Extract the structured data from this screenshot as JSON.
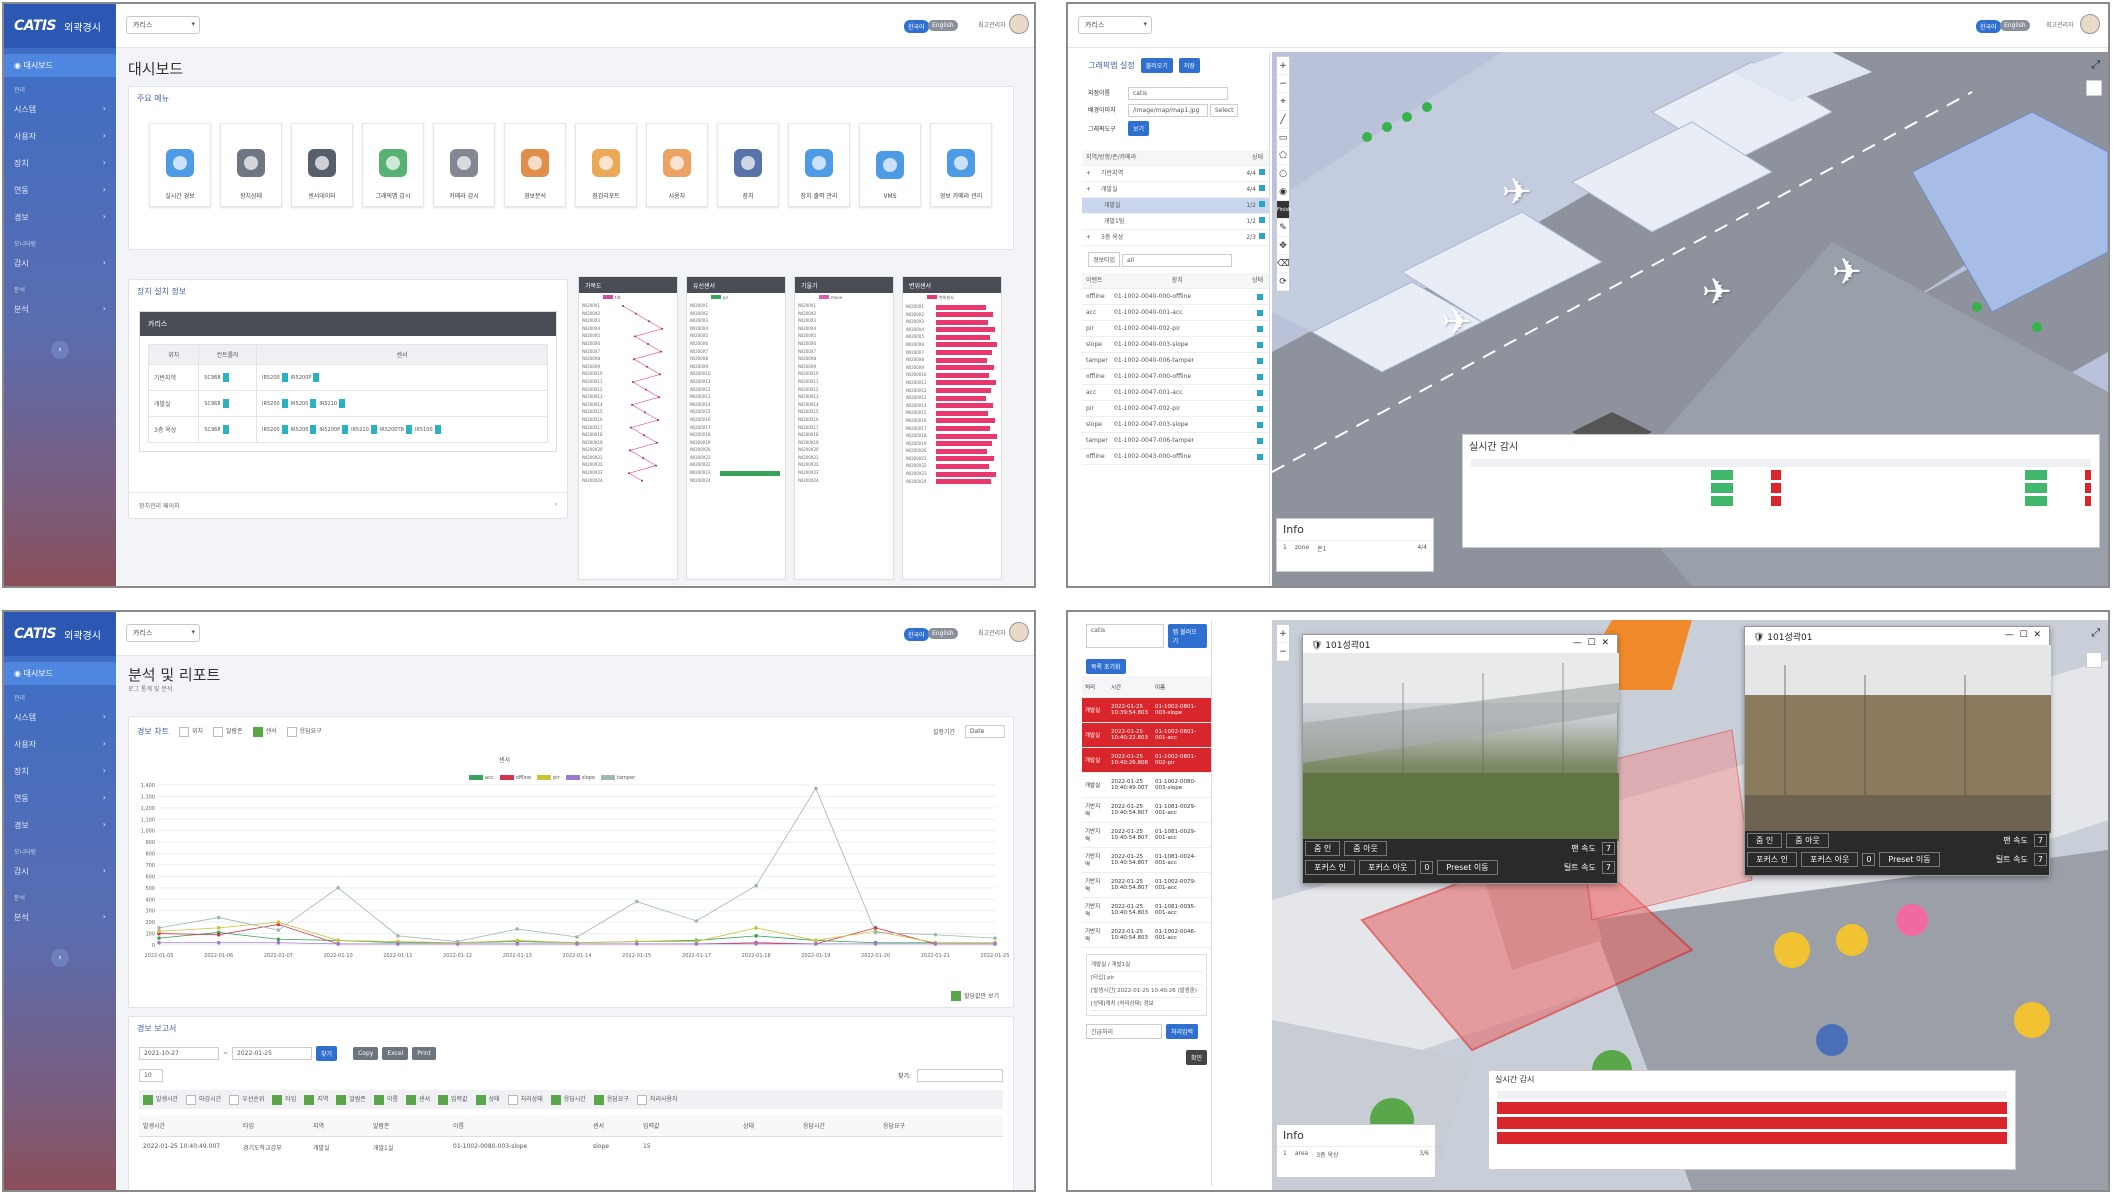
{
  "common": {
    "brand_logo": "CATIS",
    "brand_title": "외곽경시",
    "site_select": "카리스",
    "lang_ko": "한국어",
    "lang_en": "English",
    "user": "최고관리자",
    "sidebar": {
      "active": "대시보드",
      "groups": [
        "관리",
        "모니터링",
        "분석"
      ],
      "items": [
        "시스템",
        "사용자",
        "장치",
        "연동",
        "경보"
      ],
      "items2": [
        "감시"
      ],
      "items3": [
        "분석"
      ],
      "collapse": "‹"
    }
  },
  "dashboard": {
    "title": "대시보드",
    "main_menu_title": "주요 메뉴",
    "menu": [
      {
        "label": "실시간 경보",
        "icon": "siren-icon"
      },
      {
        "label": "장치상태",
        "icon": "server-status-icon"
      },
      {
        "label": "센서데이터",
        "icon": "drone-icon"
      },
      {
        "label": "그래픽맵 감시",
        "icon": "map-icon"
      },
      {
        "label": "카메라 감시",
        "icon": "cctv-icon"
      },
      {
        "label": "경보분석",
        "icon": "presentation-icon"
      },
      {
        "label": "점검리포트",
        "icon": "clipboard-icon"
      },
      {
        "label": "사용자",
        "icon": "user-icon"
      },
      {
        "label": "장치",
        "icon": "gear-network-icon"
      },
      {
        "label": "장치 출력 관리",
        "icon": "database-icon"
      },
      {
        "label": "VMS",
        "icon": "folder-camera-icon"
      },
      {
        "label": "경보 카메라 관리",
        "icon": "db-camera-icon"
      }
    ],
    "device_title": "장치 설치 정보",
    "device_site": "카리스",
    "device_headers": [
      "위치",
      "컨트롤러",
      "센서"
    ],
    "device_rows": [
      {
        "loc": "기반지역",
        "ctrl": "SC968",
        "sensors": [
          "IR5200",
          "IR5200P"
        ]
      },
      {
        "loc": "개발실",
        "ctrl": "SC968",
        "sensors": [
          "IR5200",
          "IR5200",
          "IR5210"
        ]
      },
      {
        "loc": "3층 옥상",
        "ctrl": "SC968",
        "sensors": [
          "IR5200",
          "IR5200",
          "IR5200P",
          "IR5210",
          "IR5200TB",
          "IR5100"
        ]
      }
    ],
    "device_footer": "장치관리 페이지",
    "mini_titles": [
      "가복도",
      "유선센서",
      "기울기",
      "변위센서"
    ],
    "mini_legends": [
      "tilt",
      "pir",
      "move",
      "변위센서"
    ],
    "mini_rows": [
      "IW200X1",
      "IW200X2",
      "IW200X3",
      "IW200X4",
      "IW200X5",
      "IW200X6",
      "IW200X7",
      "IW200X8",
      "IW200X9",
      "IW200X10",
      "IW200X11",
      "IW200X12",
      "IW200X13",
      "IW200X14",
      "IW200X15",
      "IW200X16",
      "IW200X17",
      "IW200X18",
      "IW200X19",
      "IW200X20",
      "IW200X21",
      "IW200X22",
      "IW200X23",
      "IW200X24"
    ]
  },
  "mapview": {
    "site_select": "카리스",
    "panel_title": "그래픽맵 설정",
    "btn_load": "불러오기",
    "btn_save": "저장",
    "name_label": "지점이름",
    "name_value": "catis",
    "path_label": "배경이미지",
    "path_value": "/image/map/map1.jpg",
    "btn_select": "Select",
    "tool_label": "그래픽도구",
    "btn_view": "보기",
    "tree_header": "지역/방향/존/카메라",
    "tree_header_state": "상태",
    "tree": [
      {
        "name": "기반지역",
        "val": "4/4"
      },
      {
        "name": "개발실",
        "val": "4/4"
      },
      {
        "name": "개발실",
        "val": "1/2"
      },
      {
        "name": "개발1팀",
        "val": "1/2"
      },
      {
        "name": "3층 옥상",
        "val": "2/3"
      }
    ],
    "filter_label": "경보타입",
    "filter_value": "all",
    "list_headers": [
      "이벤트",
      "장치",
      "상태"
    ],
    "list": [
      {
        "t": "offline",
        "d": "01-1002-0040-000-offline"
      },
      {
        "t": "acc",
        "d": "01-1002-0040-001-acc"
      },
      {
        "t": "pir",
        "d": "01-1002-0040-002-pir"
      },
      {
        "t": "slope",
        "d": "01-1002-0040-003-slope"
      },
      {
        "t": "tamper",
        "d": "01-1002-0040-006-tamper"
      },
      {
        "t": "offline",
        "d": "01-1002-0047-000-offline"
      },
      {
        "t": "acc",
        "d": "01-1002-0047-001-acc"
      },
      {
        "t": "pir",
        "d": "01-1002-0047-002-pir"
      },
      {
        "t": "slope",
        "d": "01-1002-0047-003-slope"
      },
      {
        "t": "tamper",
        "d": "01-1002-0047-006-tamper"
      },
      {
        "t": "offline",
        "d": "01-1002-0043-000-offline"
      }
    ],
    "finish": "Finish",
    "info_title": "Info",
    "info_row": [
      "1",
      "zone",
      "존1",
      "4/4"
    ],
    "realtime_title": "실시간 감시"
  },
  "analysis": {
    "title": "분석 및 리포트",
    "subtitle": "로그 통계 및 분석",
    "chart_title": "경보 차트",
    "chart_filters": [
      {
        "label": "위치",
        "on": false
      },
      {
        "label": "알람존",
        "on": false
      },
      {
        "label": "센서",
        "on": true
      },
      {
        "label": "응답요구",
        "on": false
      }
    ],
    "period_label": "설정기간",
    "period_value": "Date",
    "show_values": "할당값만 보기",
    "report_title": "경보 보고서",
    "date_from": "2021-10-27",
    "date_to": "2022-01-25",
    "btn_search": "찾기",
    "btn_copy": "Copy",
    "btn_excel": "Excel",
    "btn_print": "Print",
    "page_size": "10",
    "search_label": "찾기:",
    "col_toggles": [
      {
        "label": "발생시간",
        "on": true
      },
      {
        "label": "마감시간",
        "on": false
      },
      {
        "label": "우선순위",
        "on": false
      },
      {
        "label": "타입",
        "on": true
      },
      {
        "label": "지역",
        "on": true
      },
      {
        "label": "알람존",
        "on": true
      },
      {
        "label": "이름",
        "on": true
      },
      {
        "label": "센서",
        "on": true
      },
      {
        "label": "입력값",
        "on": true
      },
      {
        "label": "상태",
        "on": true
      },
      {
        "label": "처리상태",
        "on": false
      },
      {
        "label": "응답시간",
        "on": true
      },
      {
        "label": "응답요구",
        "on": true
      },
      {
        "label": "처리사용자",
        "on": false
      }
    ],
    "report_headers": [
      "발생시간",
      "타입",
      "지역",
      "알람존",
      "이름",
      "센서",
      "입력값",
      "상태",
      "응답시간",
      "응답요구"
    ],
    "report_row": [
      "2022-01-25 10:40:49.007",
      "경기도학교감부",
      "개발실",
      "개발1실",
      "01-1002-0080-003-slope",
      "slope",
      "15",
      "",
      "",
      ""
    ]
  },
  "chart_data": {
    "type": "line",
    "title": "센서",
    "x": [
      "2022-01-05",
      "2022-01-06",
      "2022-01-07",
      "2022-01-10",
      "2022-01-11",
      "2022-01-12",
      "2022-01-13",
      "2022-01-14",
      "2022-01-15",
      "2022-01-17",
      "2022-01-18",
      "2022-01-19",
      "2022-01-20",
      "2022-01-21",
      "2022-01-25"
    ],
    "ylim": [
      0,
      1400
    ],
    "yticks": [
      0,
      100,
      200,
      300,
      400,
      500,
      600,
      700,
      800,
      900,
      1000,
      1100,
      1200,
      1300,
      1400
    ],
    "ytick_labels": [
      "0",
      "100",
      "200",
      "300",
      "400",
      "500",
      "600",
      "700",
      "800",
      "900",
      "1,000",
      "1,100",
      "1,200",
      "1,300",
      "1,400"
    ],
    "series": [
      {
        "name": "acc",
        "color": "#3aa35a",
        "values": [
          60,
          110,
          50,
          40,
          20,
          20,
          30,
          20,
          30,
          40,
          80,
          40,
          20,
          20,
          20
        ]
      },
      {
        "name": "offline",
        "color": "#d6334c",
        "values": [
          100,
          90,
          180,
          10,
          10,
          10,
          10,
          10,
          10,
          10,
          20,
          10,
          150,
          10,
          10
        ]
      },
      {
        "name": "pir",
        "color": "#c9c23a",
        "values": [
          120,
          150,
          200,
          40,
          30,
          20,
          40,
          20,
          30,
          30,
          150,
          40,
          120,
          20,
          20
        ]
      },
      {
        "name": "slope",
        "color": "#9a7bd3",
        "values": [
          20,
          20,
          20,
          10,
          10,
          10,
          10,
          10,
          10,
          10,
          10,
          10,
          10,
          10,
          10
        ]
      },
      {
        "name": "tamper",
        "color": "#9fb8a8",
        "values": [
          150,
          240,
          130,
          500,
          80,
          30,
          140,
          70,
          380,
          210,
          520,
          1370,
          110,
          90,
          60
        ]
      }
    ]
  },
  "cctv": {
    "search_value": "catis",
    "btn_load": "맵 불러오기",
    "btn_add": "목록 초기화",
    "list_headers": [
      "처리",
      "시간",
      "이름"
    ],
    "events": [
      {
        "state": "개발실",
        "time": "2022-01-25 10:39:54.803",
        "name": "01-1002-0801-003-slope",
        "alarm": true
      },
      {
        "state": "개발실",
        "time": "2022-01-25 10:40:22.803",
        "name": "01-1002-0801-001-acc",
        "alarm": true
      },
      {
        "state": "개발실",
        "time": "2022-01-25 10:40:26.808",
        "name": "01-1002-0801-002-pir",
        "alarm": true
      },
      {
        "state": "개발실",
        "time": "2022-01-25 10:40:49.007",
        "name": "01-1002-0080-003-slope",
        "alarm": false
      },
      {
        "state": "기반지역",
        "time": "2022-01-25 10:40:54.807",
        "name": "01-1081-0029-001-acc",
        "alarm": false
      },
      {
        "state": "기반지역",
        "time": "2022-01-25 10:40:54.807",
        "name": "01-1081-0029-001-acc",
        "alarm": false
      },
      {
        "state": "기반지역",
        "time": "2022-01-25 10:40:54.807",
        "name": "01-1081-0024-001-acc",
        "alarm": false
      },
      {
        "state": "기반지역",
        "time": "2022-01-25 10:40:54.807",
        "name": "01-1002-0079-001-acc",
        "alarm": false
      },
      {
        "state": "기반지역",
        "time": "2022-01-25 10:40:54.803",
        "name": "01-1081-0035-001-acc",
        "alarm": false
      },
      {
        "state": "기반지역",
        "time": "2022-01-25 10:40:54.803",
        "name": "01-1002-0046-001-acc",
        "alarm": false
      }
    ],
    "detail_lines": [
      "개발실 / 개발1실",
      "[타입] pir",
      "[발생시간] 2022-01-25 10:40:26 (발생중)",
      "[상태]캐치 (처리상태) 경보"
    ],
    "detail_select": "긴급처리",
    "btn_process": "처리입력",
    "btn_confirm": "확인",
    "cam_title": "101성곽01",
    "btn_zoom_in": "줌 인",
    "btn_zoom_out": "줌 아웃",
    "btn_focus_in": "포커스 인",
    "btn_focus_out": "포커스 아웃",
    "preset_num": "0",
    "btn_preset": "Preset 이동",
    "pan_speed": "팬 속도",
    "tilt_speed": "틸트 속도",
    "speed_value": "7",
    "info_title": "Info",
    "info_row": [
      "1",
      "area",
      "3층 옥상",
      "3/6"
    ],
    "realtime_title": "실시간 감시"
  }
}
